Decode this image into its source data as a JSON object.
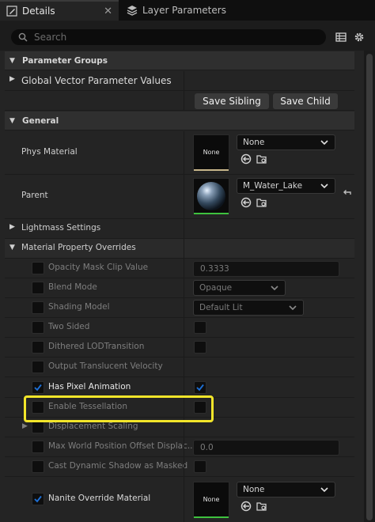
{
  "tabs": [
    {
      "label": "Details",
      "icon": "pencil-icon",
      "closable": true
    },
    {
      "label": "Layer Parameters",
      "icon": "layers-icon"
    }
  ],
  "search": {
    "placeholder": "Search"
  },
  "categories": {
    "parameter_groups": "Parameter Groups",
    "general": "General",
    "lightmass": "Lightmass Settings",
    "overrides": "Material Property Overrides"
  },
  "global_vector": {
    "label": "Global Vector Parameter Values",
    "save_sibling": "Save Sibling",
    "save_child": "Save Child"
  },
  "general": {
    "phys_material": {
      "label": "Phys Material",
      "thumb": "None",
      "value": "None"
    },
    "parent": {
      "label": "Parent",
      "value": "M_Water_Lake"
    }
  },
  "overrides": {
    "opacity_mask": {
      "label": "Opacity Mask Clip Value",
      "value": "0.3333",
      "checked": false
    },
    "blend_mode": {
      "label": "Blend Mode",
      "value": "Opaque",
      "checked": false
    },
    "shading_model": {
      "label": "Shading Model",
      "value": "Default Lit",
      "checked": false
    },
    "two_sided": {
      "label": "Two Sided",
      "checked": false,
      "value_checked": false
    },
    "dithered": {
      "label": "Dithered LODTransition",
      "checked": false,
      "value_checked": false
    },
    "translucent_velocity": {
      "label": "Output Translucent Velocity",
      "checked": false
    },
    "pixel_animation": {
      "label": "Has Pixel Animation",
      "checked": true,
      "value_checked": true
    },
    "tessellation": {
      "label": "Enable Tessellation",
      "checked": false,
      "value_checked": false
    },
    "displacement": {
      "label": "Displacement Scaling",
      "checked": false
    },
    "max_wpo": {
      "label": "Max World Position Offset Displac...",
      "value": "0.0",
      "checked": false
    },
    "cast_shadow": {
      "label": "Cast Dynamic Shadow as Masked",
      "checked": false,
      "value_checked": false
    },
    "nanite": {
      "label": "Nanite Override Material",
      "checked": true,
      "thumb": "None",
      "value": "None"
    }
  },
  "colors": {
    "accent": "#1d6fd6",
    "highlight": "#f2e52a",
    "asset_bar_none": "#c8b68a",
    "asset_bar_parent": "#3ec23e"
  }
}
